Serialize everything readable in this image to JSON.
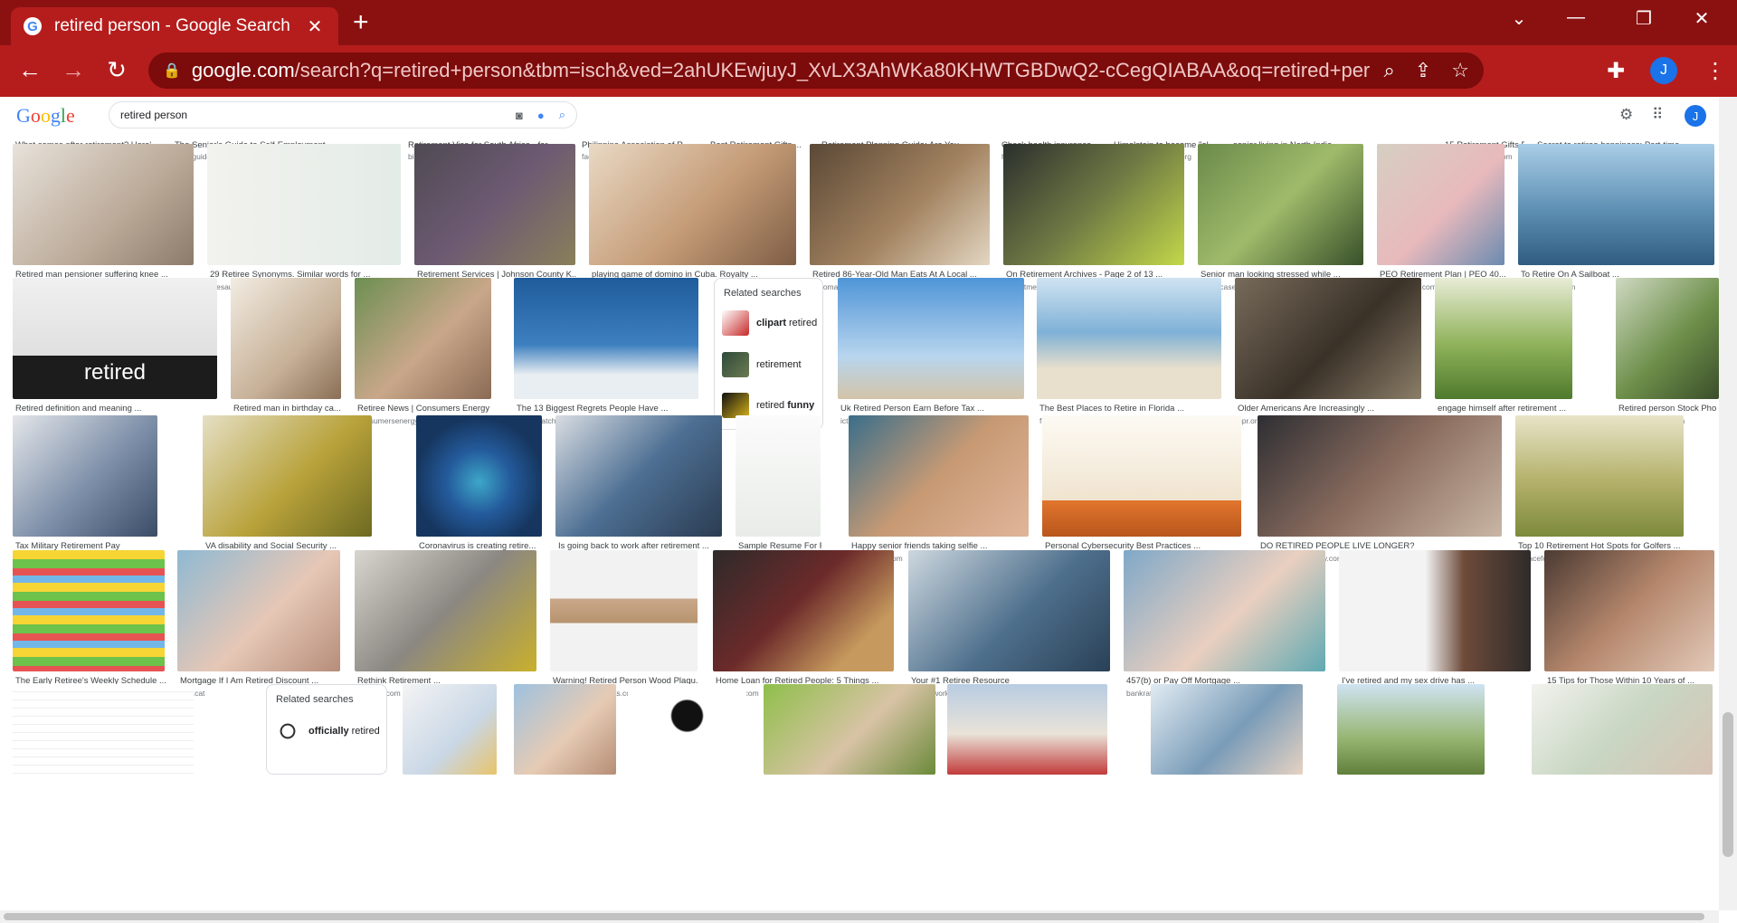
{
  "browser": {
    "tab_title": "retired person - Google Search",
    "favicon_letter": "G",
    "tab_close": "✕",
    "new_tab": "+",
    "win_min": "—",
    "win_max": "❐",
    "win_close": "✕",
    "url_host": "google.com",
    "url_path": "/search?q=retired+person&tbm=isch&ved=2ahUKEwjuyJ_XvLX3AhWKa80KHWTGBDwQ2-cCegQIABAA&oq=retired+person&gs_lcp=Cg...",
    "profile_letter": "J"
  },
  "google": {
    "logo": [
      "G",
      "o",
      "o",
      "g",
      "l",
      "e"
    ],
    "query": "retired person",
    "avatar_letter": "J"
  },
  "top_captions": [
    {
      "cap": "What comes after retirement? Here'...",
      "src": "m.economictimes.com"
    },
    {
      "cap": "The Senior's Guide to Self-Employment ...",
      "src": "retireguide.com"
    },
    {
      "cap": "Retirement Visa for South Africa - for ...",
      "src": "bic-immigration.com"
    },
    {
      "cap": "Philippine Association of R...",
      "src": "facebook.com"
    },
    {
      "cap": "Best Retirement Gifts ...",
      "src": "lsmejd.com"
    },
    {
      "cap": "Retirement Planning Guide: Are You ...",
      "src": "investopedia.com"
    },
    {
      "cap": "Check health insurance...",
      "src": "hitachi-kenpo.or.jp"
    },
    {
      "cap": "Himelstein to become \"ol...",
      "src": "basementmedicine.org"
    },
    {
      "cap": "senior living in North India ...",
      "src": "edenseniors.com"
    },
    {
      "cap": "15 Retirement Gifts For ...",
      "src": "trueclassictees.com"
    },
    {
      "cap": "Secret to retiree happiness: Part-time ...",
      "src": "marketwatch.com"
    }
  ],
  "rows": [
    [
      {
        "cap": "Retired man pensioner suffering knee ...",
        "src": "freepik.com"
      },
      {
        "cap": "29 Retiree Synonyms. Similar words for ...",
        "src": "thesaurus.plus"
      },
      {
        "cap": "Retirement Services | Johnson County K...",
        "src": "jocogov.org"
      },
      {
        "cap": "playing game of domino in Cuba. Royalty ...",
        "src": "storyblocks.com"
      },
      {
        "cap": "Retired 86-Year-Old Man Eats At A Local ...",
        "src": "12tomatoes.com"
      },
      {
        "cap": "On Retirement Archives - Page 2 of 13 ...",
        "src": "investmentnews.com"
      },
      {
        "cap": "Senior man looking stressed while ...",
        "src": "photocase.com"
      },
      {
        "cap": "PEO Retirement Plan | PEO 40...",
        "src": "prestigepeo.com"
      },
      {
        "cap": "To Retire On A Sailboat ...",
        "src": "lifeofsailing.com"
      }
    ],
    [
      {
        "cap": "Retired definition and meaning ...",
        "src": "collinsdictionary.com",
        "overlay": "retired"
      },
      {
        "cap": "Retired man in birthday ca...",
        "src": "elements.envato.com"
      },
      {
        "cap": "Retiree News | Consumers Energy",
        "src": "consumersenergy.com"
      },
      {
        "cap": "The 13 Biggest Regrets People Have ...",
        "src": "wallstwatchdog.com"
      },
      {
        "cap": "Uk Retired Person Earn Before Tax ...",
        "src": "ictsd.org"
      },
      {
        "cap": "The Best Places to Retire in Florida ...",
        "src": "florida-guidebook.com"
      },
      {
        "cap": "Older Americans Are Increasingly ...",
        "src": "npr.org"
      },
      {
        "cap": "engage himself after retirement ...",
        "src": "quora.com"
      },
      {
        "cap": "Retired person Stock Pho",
        "src": "canstockphoto.com"
      }
    ],
    [
      {
        "cap": "Tax Military Retirement Pay",
        "src": "themilitarywallet.com"
      },
      {
        "cap": "VA disability and Social Security ...",
        "src": "woodslawyers.com"
      },
      {
        "cap": "Coronavirus is creating retire...",
        "src": "weforum.org"
      },
      {
        "cap": "Is going back to work after retirement ...",
        "src": "restless.co.uk"
      },
      {
        "cap": "Sample Resume For Re...",
        "src": "sumry.me"
      },
      {
        "cap": "Happy senior friends taking selfie ...",
        "src": "crushpixel.com"
      },
      {
        "cap": "Personal Cybersecurity Best Practices ...",
        "src": "cybertakes.com"
      },
      {
        "cap": "DO RETIRED PEOPLE LIVE LONGER?",
        "src": "worldlifeexpectancy.com"
      },
      {
        "cap": "Top 10 Retirement Hot Spots for Golfers ...",
        "src": "aplaceformom.com"
      }
    ],
    [
      {
        "cap": "The Early Retiree's Weekly Schedule ...",
        "src": "rootofgood.com"
      },
      {
        "cap": "Mortgage If I Am Retired Discount ...",
        "src": "hcb.cat"
      },
      {
        "cap": "Rethink Retirement ...",
        "src": "nytimes.com"
      },
      {
        "cap": "Warning! Retired Person Wood Plaqu...",
        "src": "surreyhomeandgifts.co.uk",
        "stock": " · In stock"
      },
      {
        "cap": "Home Loan for Retired People: 5 Things ...",
        "src": "news18.com"
      },
      {
        "cap": "Your #1 Retiree Resource",
        "src": "retireeworkforce.com"
      },
      {
        "cap": "457(b) or Pay Off Mortgage ...",
        "src": "bankrate.com"
      },
      {
        "cap": "I've retired and my sex drive has ...",
        "src": "theguardian.com"
      },
      {
        "cap": "15 Tips for Those Within 10 Years of ...",
        "src": "moneytalksnews.com"
      }
    ]
  ],
  "related_1": {
    "title": "Related searches",
    "items": [
      {
        "bold": "clipart",
        "rest": "retired"
      },
      {
        "bold": "",
        "rest": "retirement"
      },
      {
        "bold": "",
        "rest": "retired",
        "bold_after": "funny"
      }
    ]
  },
  "related_2": {
    "title": "Related searches",
    "items": [
      {
        "bold": "officially",
        "rest": "retired"
      }
    ]
  },
  "icons": {
    "back": "←",
    "forward": "→",
    "reload": "↻",
    "lock": "🔒",
    "zoom": "🔍",
    "share": "⇪",
    "star": "☆",
    "extensions": "✚",
    "menu": "⋮",
    "settings": "⚙",
    "apps": "⠿",
    "camera": "📷",
    "mic": "🎤",
    "search": "🔍"
  },
  "colors": {
    "tab_strip": "#8b1111",
    "toolbar": "#b51d1d",
    "omnibox": "#7c0b0b"
  }
}
